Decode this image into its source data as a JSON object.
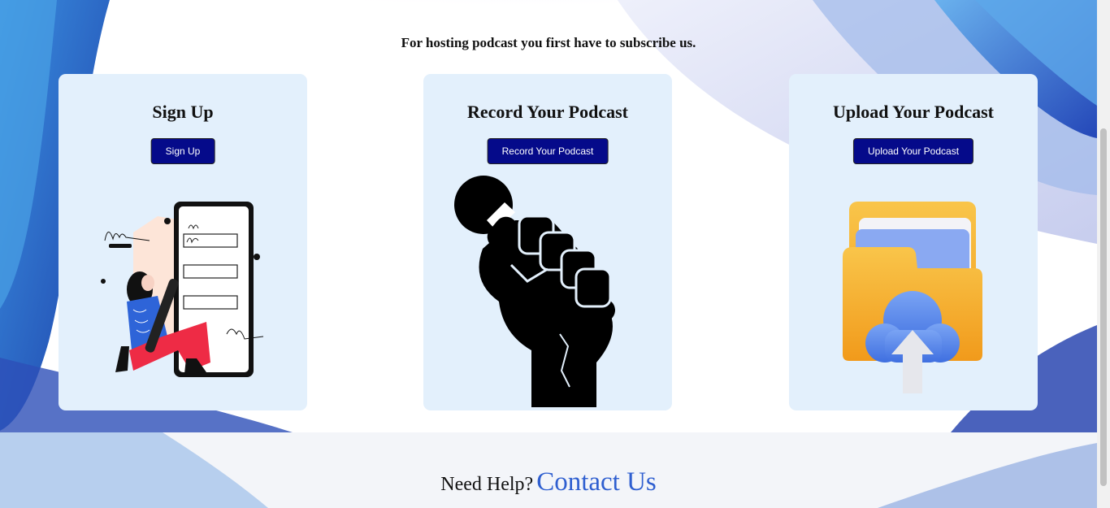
{
  "intro_text": "For hosting podcast you first have to subscribe us.",
  "cards": [
    {
      "title": "Sign Up",
      "button": "Sign Up"
    },
    {
      "title": "Record Your Podcast",
      "button": "Record Your Podcast"
    },
    {
      "title": "Upload Your Podcast",
      "button": "Upload Your Podcast"
    }
  ],
  "footer": {
    "question": "Need Help?",
    "link": "Contact Us"
  },
  "colors": {
    "button": "#050a8a",
    "card": "#e3f0fc",
    "link": "#2f5fd0"
  },
  "icons": [
    "signup-illustration",
    "microphone-fist-icon",
    "folder-upload-icon"
  ]
}
